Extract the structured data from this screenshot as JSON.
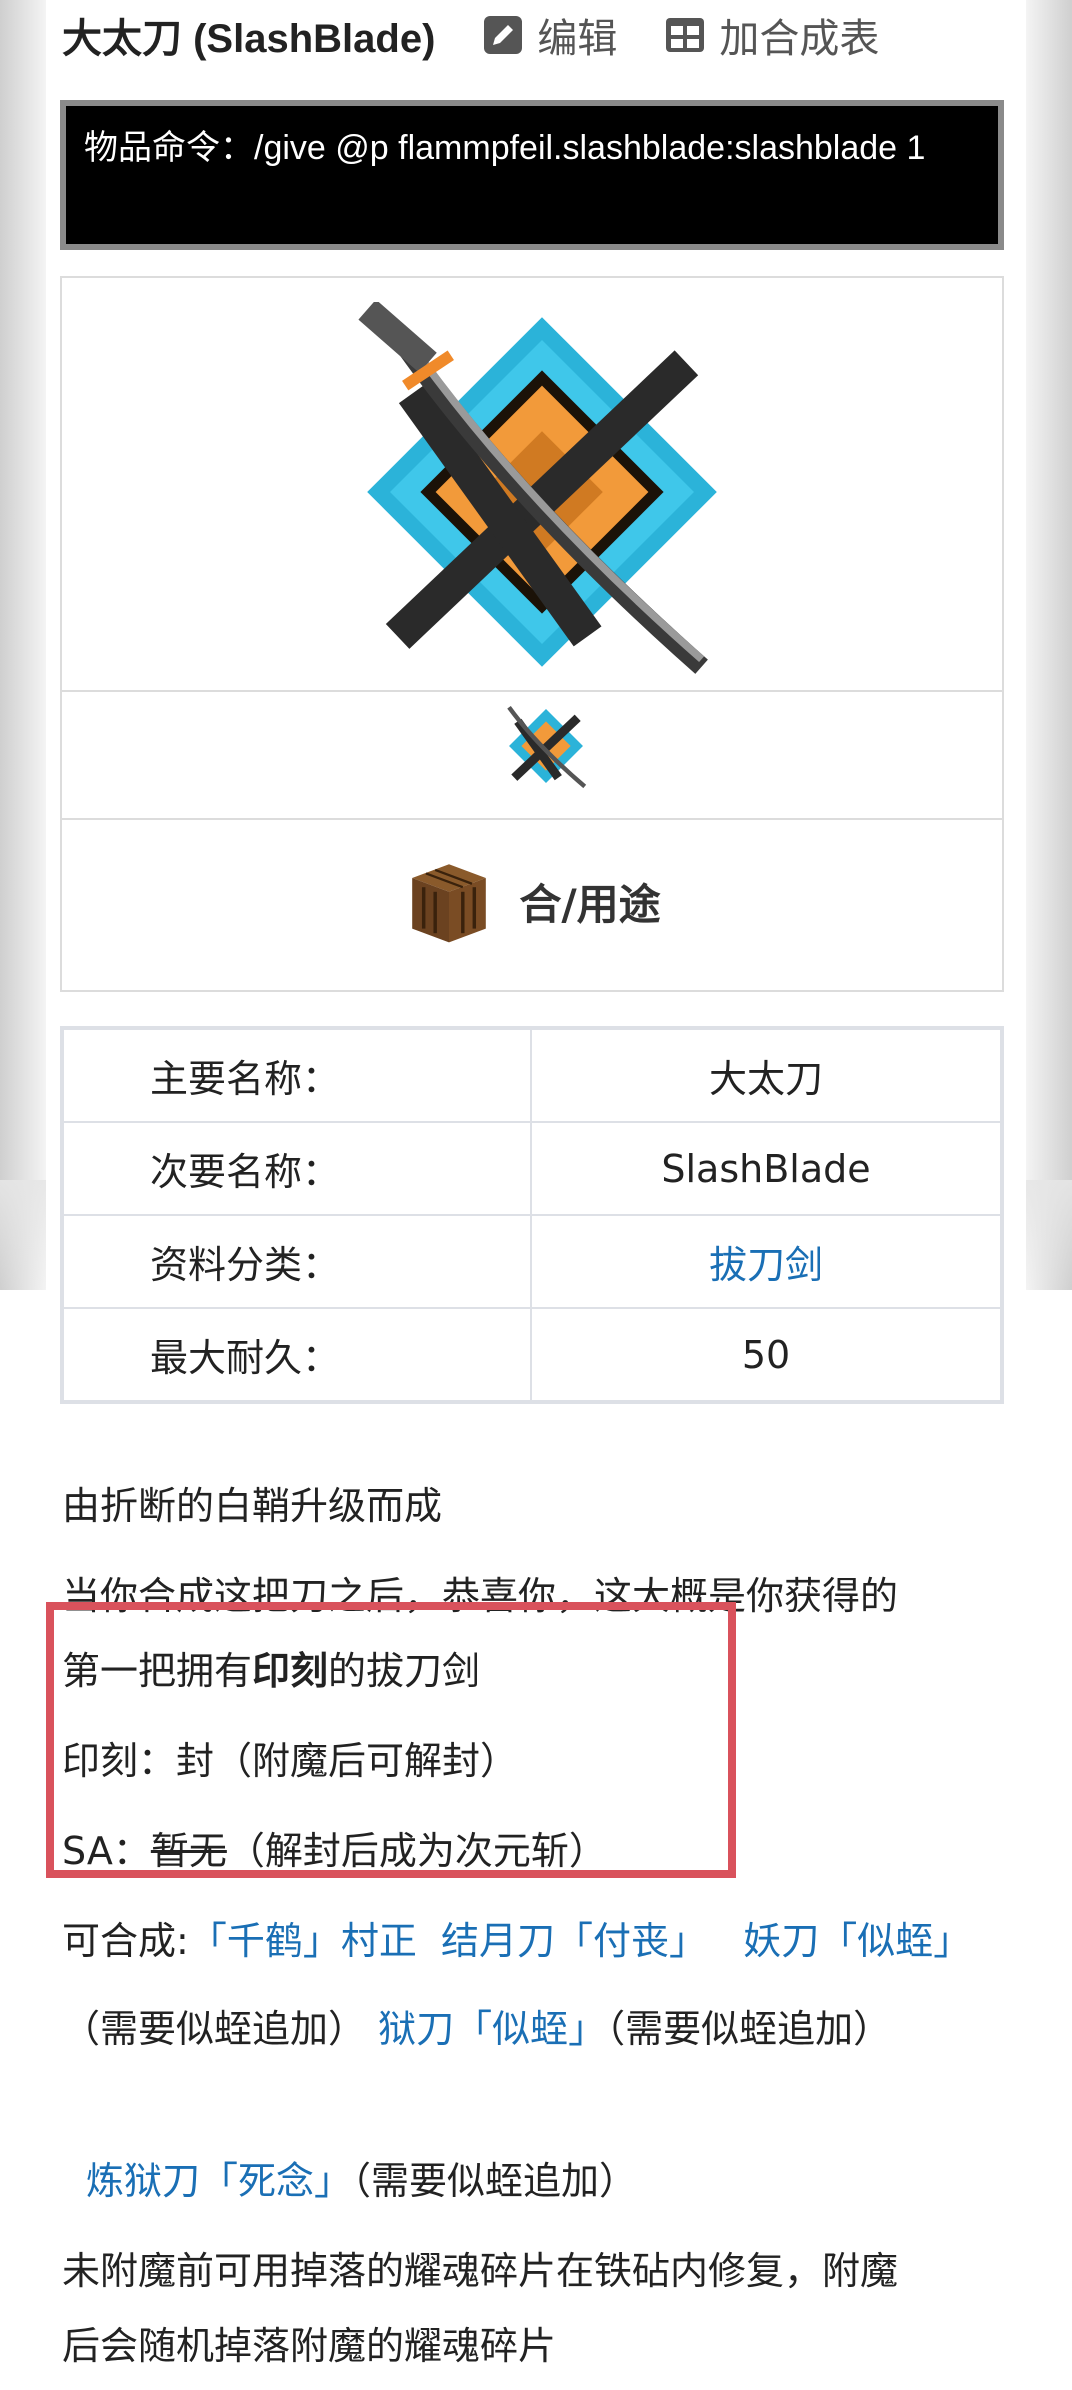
{
  "header": {
    "title": "大太刀 (SlashBlade)",
    "edit_label": "编辑",
    "recipe_label": "加合成表"
  },
  "command": {
    "text": "物品命令：/give @p flammpfeil.slashblade:slashblade 1"
  },
  "item_box": {
    "craft_label": "合/用途"
  },
  "info_table": {
    "rows": [
      {
        "key": "主要名称：",
        "value": "大太刀"
      },
      {
        "key": "次要名称：",
        "value": "SlashBlade"
      },
      {
        "key": "资料分类：",
        "value": "拔刀剑"
      },
      {
        "key": "最大耐久：",
        "value": "50"
      }
    ]
  },
  "description": {
    "line1": "由折断的白鞘升级而成",
    "line2": "当你合成这把刀之后，恭喜你，这大概是你获得的",
    "line3_pre": "第一把拥有",
    "line3_bold": "印刻",
    "line3_post": "的拔刀剑",
    "line4": "印刻：封（附魔后可解封）",
    "line5_pre": "SA：",
    "line5_strike": "暂无",
    "line5_post": "（解封后成为次元斩）",
    "craftable_label": "可合成:",
    "craft_items": [
      {
        "name": "「千鹤」村正",
        "note": ""
      },
      {
        "name": "结月刀「付丧」",
        "note": ""
      },
      {
        "name": "妖刀「似蛭」",
        "note": "（需要似蛭追加）"
      },
      {
        "name": "狱刀「似蛭」",
        "note": "（需要似蛭追加）"
      },
      {
        "name": "炼狱刀「死念」",
        "note": "（需要似蛭追加）"
      }
    ],
    "repair_line1": "未附魔前可用掉落的耀魂碎片在铁砧内修复，附魔",
    "repair_line2": "后会随机掉落附魔的耀魂碎片"
  },
  "colors": {
    "link": "#1a6fb5",
    "highlight_border": "#d9525c",
    "command_bg": "#000000"
  }
}
